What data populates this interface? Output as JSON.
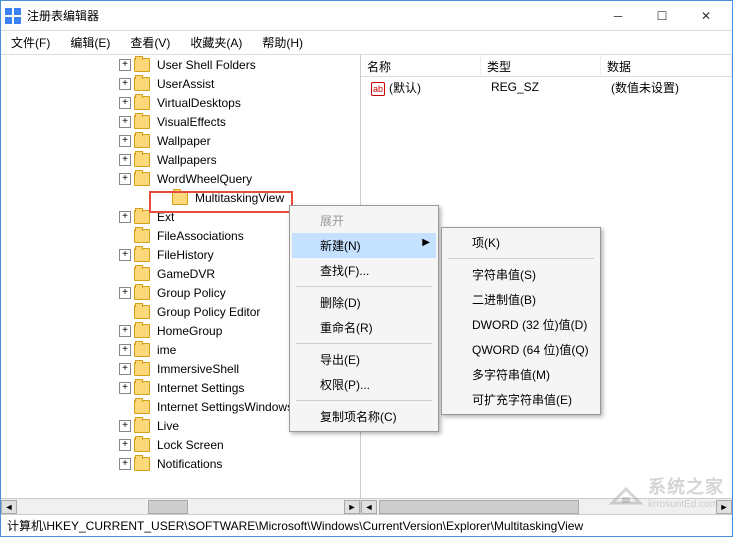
{
  "window": {
    "title": "注册表编辑器"
  },
  "menubar": {
    "file": "文件(F)",
    "edit": "编辑(E)",
    "view": "查看(V)",
    "fav": "收藏夹(A)",
    "help": "帮助(H)"
  },
  "tree": {
    "items": [
      {
        "label": "User Shell Folders",
        "level": 1,
        "expandable": true
      },
      {
        "label": "UserAssist",
        "level": 1,
        "expandable": true
      },
      {
        "label": "VirtualDesktops",
        "level": 1,
        "expandable": true
      },
      {
        "label": "VisualEffects",
        "level": 1,
        "expandable": true
      },
      {
        "label": "Wallpaper",
        "level": 1,
        "expandable": true
      },
      {
        "label": "Wallpapers",
        "level": 1,
        "expandable": true
      },
      {
        "label": "WordWheelQuery",
        "level": 1,
        "expandable": true
      },
      {
        "label": "MultitaskingView",
        "level": 2,
        "expandable": false,
        "highlight": true
      },
      {
        "label": "Ext",
        "level": 1,
        "expandable": true
      },
      {
        "label": "FileAssociations",
        "level": 1,
        "expandable": false
      },
      {
        "label": "FileHistory",
        "level": 1,
        "expandable": true
      },
      {
        "label": "GameDVR",
        "level": 1,
        "expandable": false
      },
      {
        "label": "Group Policy",
        "level": 1,
        "expandable": true
      },
      {
        "label": "Group Policy Editor",
        "level": 1,
        "expandable": false
      },
      {
        "label": "HomeGroup",
        "level": 1,
        "expandable": true
      },
      {
        "label": "ime",
        "level": 1,
        "expandable": true
      },
      {
        "label": "ImmersiveShell",
        "level": 1,
        "expandable": true
      },
      {
        "label": "Internet Settings",
        "level": 1,
        "expandable": true
      },
      {
        "label": "Internet SettingsWindows",
        "level": 1,
        "expandable": false
      },
      {
        "label": "Live",
        "level": 1,
        "expandable": true
      },
      {
        "label": "Lock Screen",
        "level": 1,
        "expandable": true
      },
      {
        "label": "Notifications",
        "level": 1,
        "expandable": true
      }
    ]
  },
  "list": {
    "columns": {
      "name": "名称",
      "type": "类型",
      "data": "数据"
    },
    "rows": [
      {
        "name": "(默认)",
        "type": "REG_SZ",
        "data": "(数值未设置)"
      }
    ]
  },
  "ctx1": {
    "expand": "展开",
    "new": "新建(N)",
    "find": "查找(F)...",
    "delete": "删除(D)",
    "rename": "重命名(R)",
    "export": "导出(E)",
    "perm": "权限(P)...",
    "copyname": "复制项名称(C)"
  },
  "ctx2": {
    "key": "项(K)",
    "string": "字符串值(S)",
    "binary": "二进制值(B)",
    "dword": "DWORD (32 位)值(D)",
    "qword": "QWORD (64 位)值(Q)",
    "multi": "多字符串值(M)",
    "expand": "可扩充字符串值(E)"
  },
  "status": {
    "path": "计算机\\HKEY_CURRENT_USER\\SOFTWARE\\Microsoft\\Windows\\CurrentVersion\\Explorer\\MultitaskingView"
  },
  "watermark": {
    "text": "系统之家",
    "url": "krrosuntEd.com"
  }
}
